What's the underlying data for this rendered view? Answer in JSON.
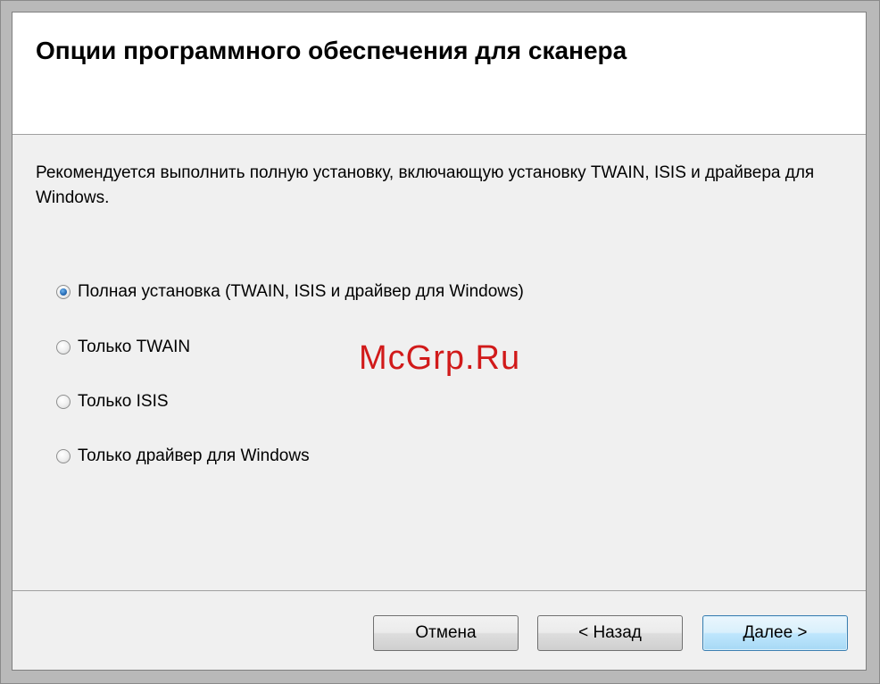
{
  "dialog": {
    "title": "Опции программного обеспечения для сканера",
    "description": "Рекомендуется выполнить полную установку, включающую установку TWAIN, ISIS и драйвера для Windows."
  },
  "options": [
    {
      "label": "Полная установка (TWAIN, ISIS и драйвер для Windows)",
      "checked": true
    },
    {
      "label": "Только TWAIN",
      "checked": false
    },
    {
      "label": "Только ISIS",
      "checked": false
    },
    {
      "label": "Только драйвер для Windows",
      "checked": false
    }
  ],
  "watermark": "McGrp.Ru",
  "buttons": {
    "cancel": "Отмена",
    "back": "< Назад",
    "next": "Далее >"
  },
  "colors": {
    "watermark": "#d11a1a",
    "default_button_border": "#3c7fb1"
  }
}
